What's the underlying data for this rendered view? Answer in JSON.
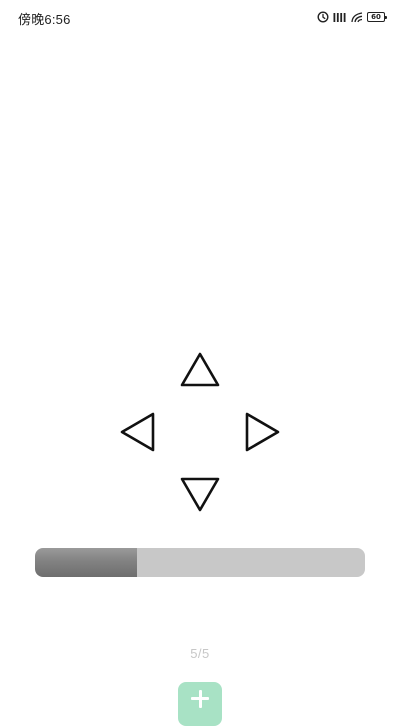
{
  "status_bar": {
    "time": "傍晚6:56",
    "battery_level": "60",
    "icons": [
      "alarm-icon",
      "signal-icon",
      "wifi-icon",
      "battery-icon"
    ]
  },
  "dpad": {
    "buttons": [
      "up-arrow-icon",
      "left-arrow-icon",
      "right-arrow-icon",
      "down-arrow-icon"
    ]
  },
  "progress": {
    "fraction": 0.31
  },
  "pager": {
    "text": "5/5"
  },
  "fab": {
    "icon": "plus-icon",
    "color": "#a8e2c5"
  }
}
